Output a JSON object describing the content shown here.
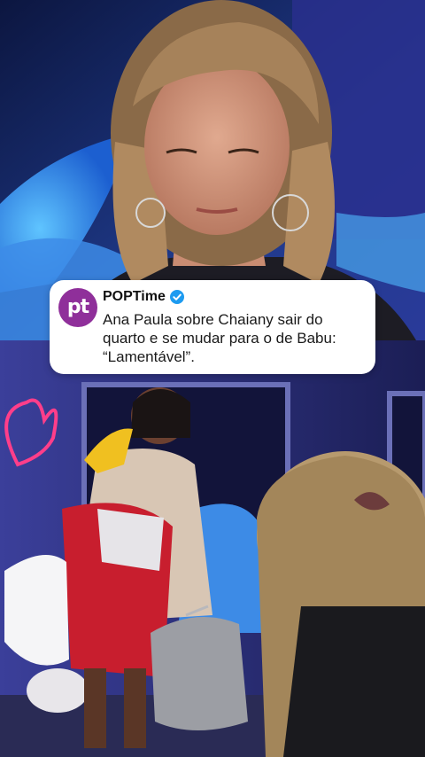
{
  "post": {
    "account_name": "POPTime",
    "avatar_initials": "pt",
    "verified_icon": "verified-badge-icon",
    "caption": "Ana Paula sobre Chaiany sair do quarto e se mudar para o de Babu: “Lamentável”."
  },
  "colors": {
    "avatar_bg": "#8f2f9a",
    "verified": "#1d9bf0",
    "card_bg": "#ffffff"
  }
}
